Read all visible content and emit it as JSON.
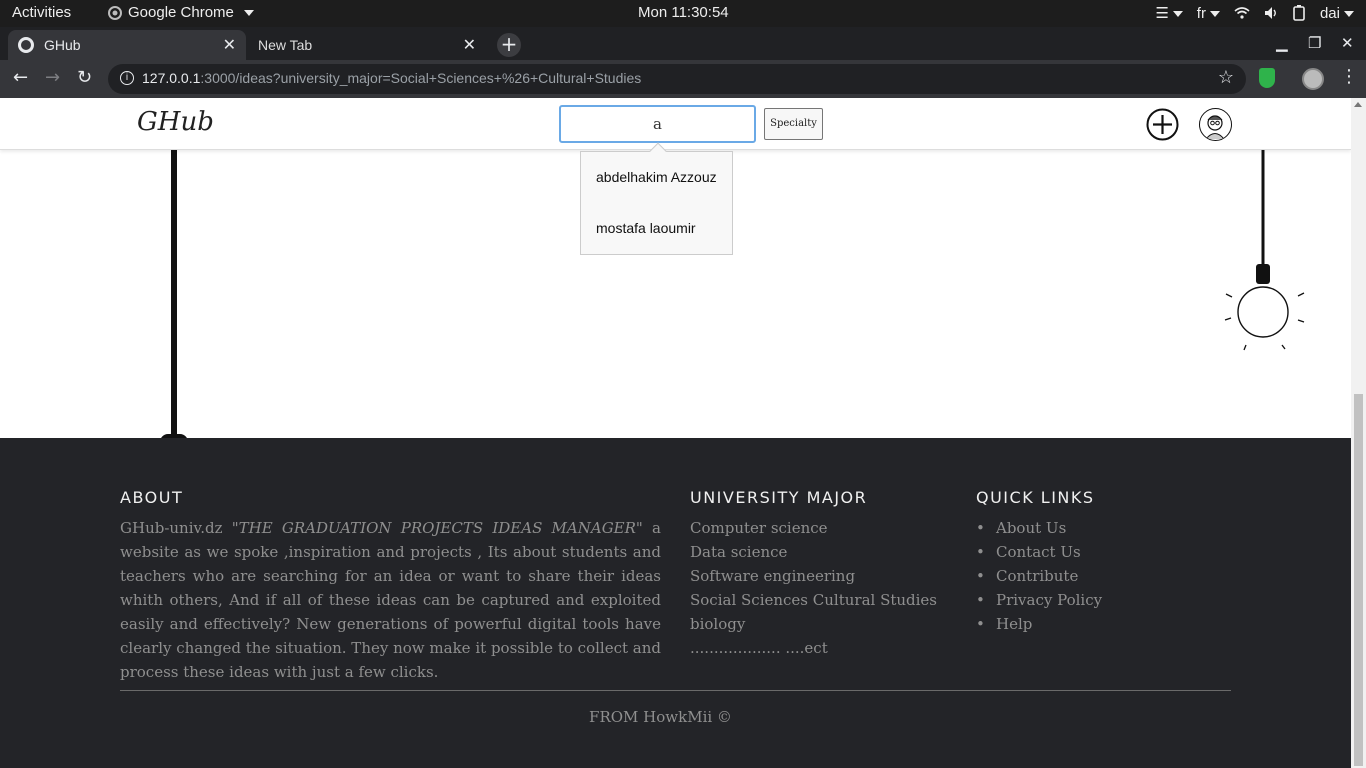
{
  "os_bar": {
    "activities": "Activities",
    "app_name": "Google Chrome",
    "clock": "Mon 11:30:54",
    "lang": "fr",
    "user": "dai"
  },
  "browser": {
    "tabs": [
      {
        "label": "GHub",
        "active": true
      },
      {
        "label": "New Tab",
        "active": false
      }
    ],
    "url_host": "127.0.0.1",
    "url_rest": ":3000/ideas?university_major=Social+Sciences+%26+Cultural+Studies",
    "shield_color": "#2fb34b"
  },
  "header": {
    "logo": "GHub",
    "search_value": "a",
    "specialty_label": "Specialty"
  },
  "search_suggestions": [
    "abdelhakim Azzouz",
    "mostafa laoumir"
  ],
  "footer": {
    "about_title": "ABOUT",
    "about_brand": "GHub-univ.dz",
    "about_quote": "\"THE GRADUATION PROJECTS IDEAS MANAGER\"",
    "about_body": " a website as we spoke ,inspiration and projects , Its about students and teachers who are searching for an idea or want to share their ideas whith others, And if all of these ideas can be captured and exploited easily and effectively? New generations of powerful digital tools have clearly changed the situation. They now make it possible to collect and process these ideas with just a few clicks.",
    "major_title": "UNIVERSITY MAJOR",
    "majors": [
      "Computer science",
      "Data science",
      "Software engineering",
      "Social Sciences Cultural Studies",
      "biology",
      "................... ....ect"
    ],
    "quick_title": "QUICK LINKS",
    "quick_links": [
      "About Us",
      "Contact Us",
      "Contribute",
      "Privacy Policy",
      "Help"
    ],
    "copyright": "FROM HowkMii ©",
    "bg_color": "#232428"
  }
}
